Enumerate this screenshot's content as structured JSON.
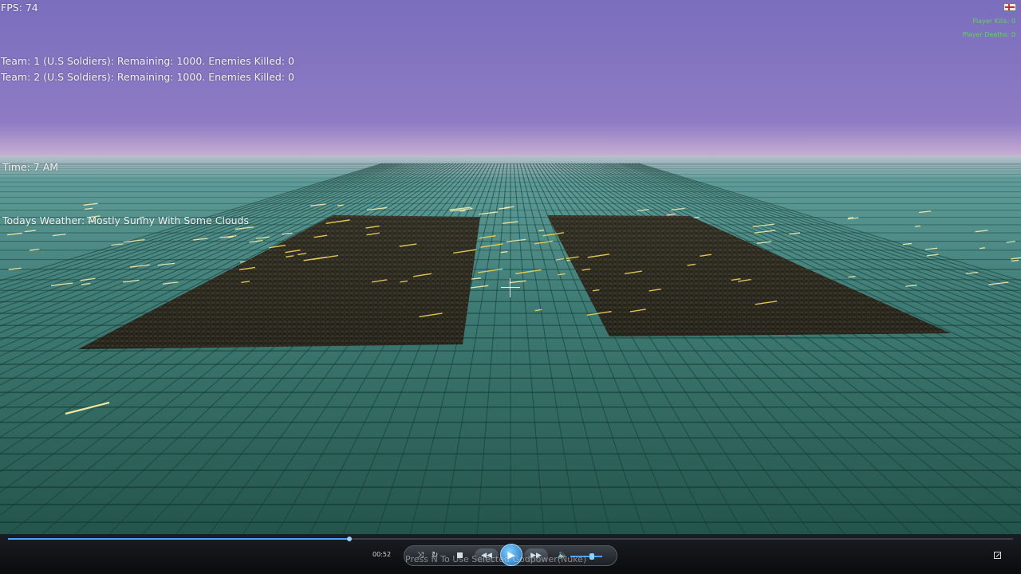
{
  "hud": {
    "fps": "FPS: 74",
    "teams": [
      "Team: 1 (U.S Soldiers): Remaining: 1000.  Enemies Killed: 0",
      "Team: 2 (U.S Soldiers): Remaining: 1000.  Enemies Killed: 0"
    ],
    "time": "Time: 7 AM",
    "weather": "Todays Weather: Mostly Sunny With Some Clouds",
    "player_kills": "Player Kills: 0",
    "player_deaths": "Player Deaths: 0"
  },
  "scene": {
    "sky_top": "#7c6fbd",
    "sky_horizon": "#d6bcd7",
    "ground_far": "#4c8b86",
    "ground_near": "#215248",
    "grid_color": "#143c33",
    "army_color": "#2b2a1e",
    "tracer_color": "#fff5b0"
  },
  "player": {
    "elapsed": "00:52",
    "progress": 0.34,
    "hint": "Press N To Use Selected Godpower(Nuke)",
    "volume": 0.6,
    "accent": "#4aa3ff"
  },
  "icons": {
    "flag": "flag-icon",
    "crosshair": "crosshair-icon",
    "play": "play-icon",
    "prev": "rewind-icon",
    "next": "fast-forward-icon",
    "stop": "stop-icon",
    "shuffle": "shuffle-icon",
    "repeat": "repeat-icon",
    "volume": "volume-icon",
    "fullscreen": "fullscreen-icon"
  }
}
